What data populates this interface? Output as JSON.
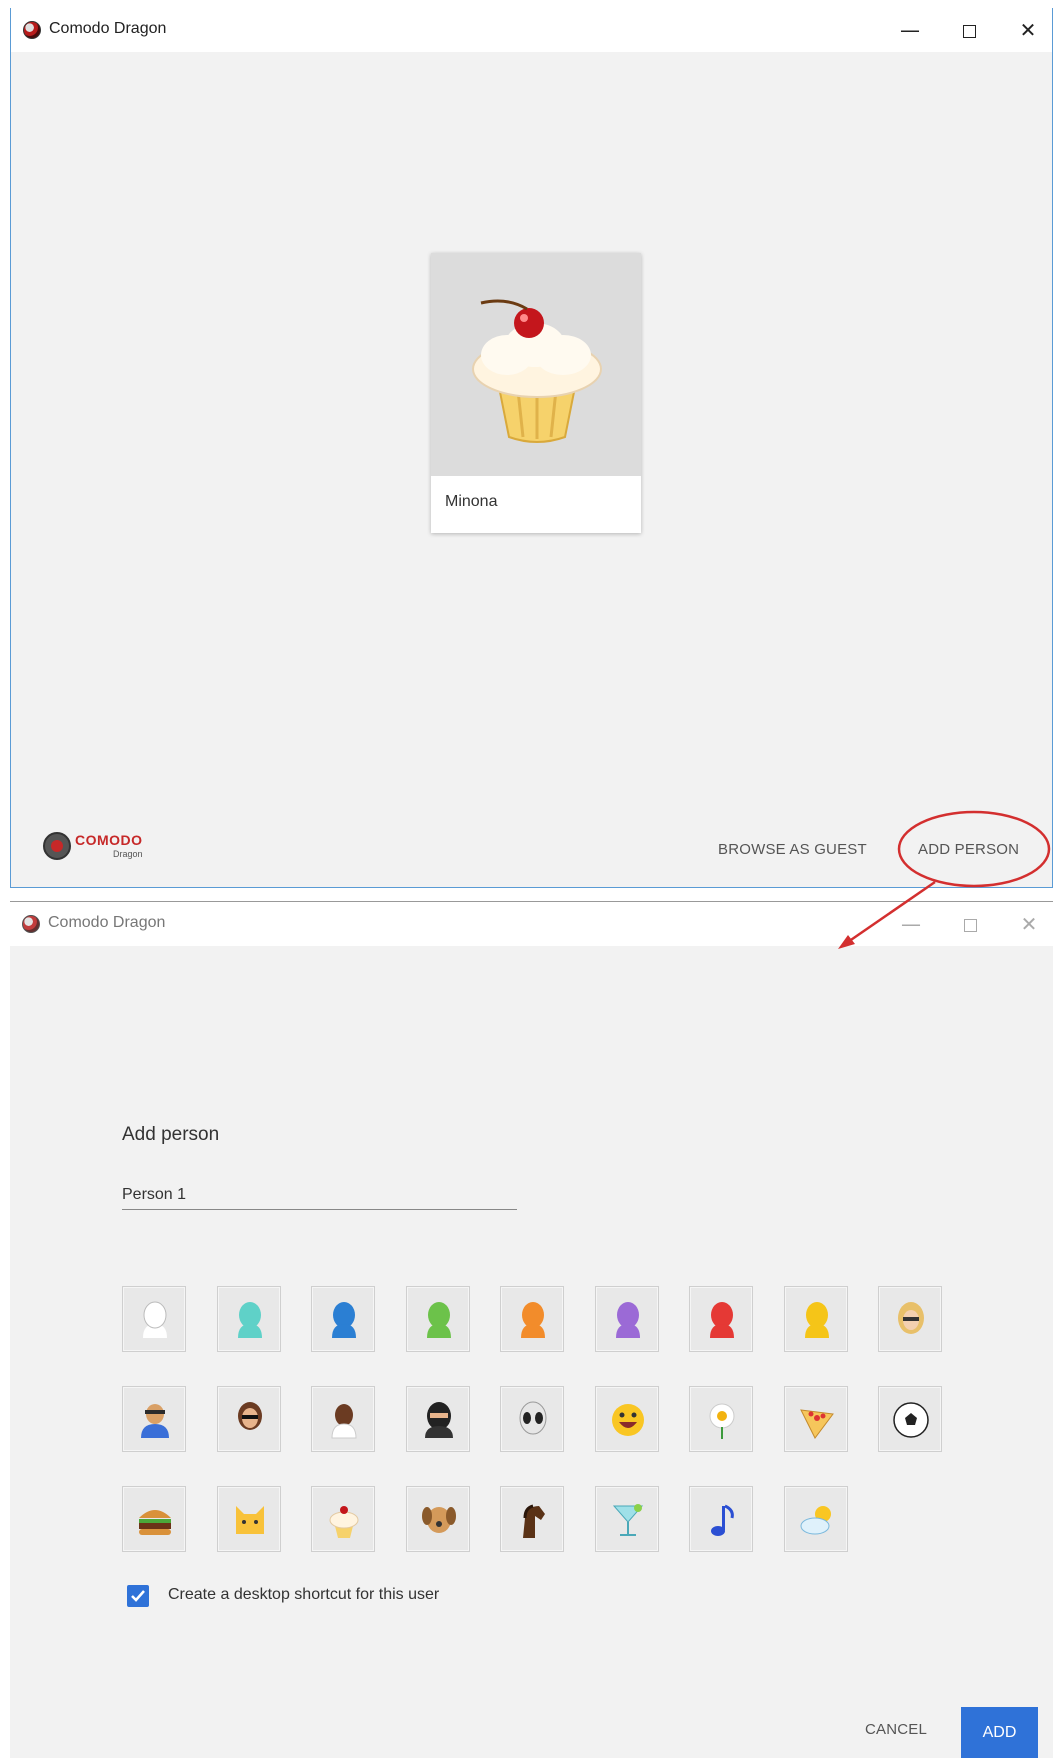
{
  "windows": {
    "top": {
      "title": "Comodo Dragon",
      "profile": {
        "name": "Minona",
        "avatar": "cupcake"
      },
      "brand": {
        "word": "COMODO",
        "sub": "Dragon"
      },
      "buttons": {
        "browse_guest": "BROWSE AS GUEST",
        "add_person": "ADD PERSON"
      }
    },
    "bottom": {
      "title": "Comodo Dragon",
      "dialog": {
        "heading": "Add person",
        "name_value": "Person 1",
        "avatars": [
          "white-silhouette",
          "teal-silhouette",
          "blue-silhouette",
          "green-silhouette",
          "orange-silhouette",
          "purple-silhouette",
          "red-silhouette",
          "yellow-silhouette",
          "blonde-woman",
          "superhero",
          "woman-sunglasses",
          "man",
          "ninja",
          "alien",
          "smiley",
          "flower",
          "pizza",
          "soccer-ball",
          "burger",
          "cat",
          "cupcake",
          "dog",
          "horse",
          "cocktail",
          "music-note",
          "sun-cloud"
        ],
        "shortcut_label": "Create a desktop shortcut for this user",
        "shortcut_checked": true,
        "cancel": "CANCEL",
        "add": "ADD"
      }
    }
  },
  "colors": {
    "accent": "#2f72d8",
    "annotation": "#d32f2f",
    "brand_red": "#c62828"
  }
}
